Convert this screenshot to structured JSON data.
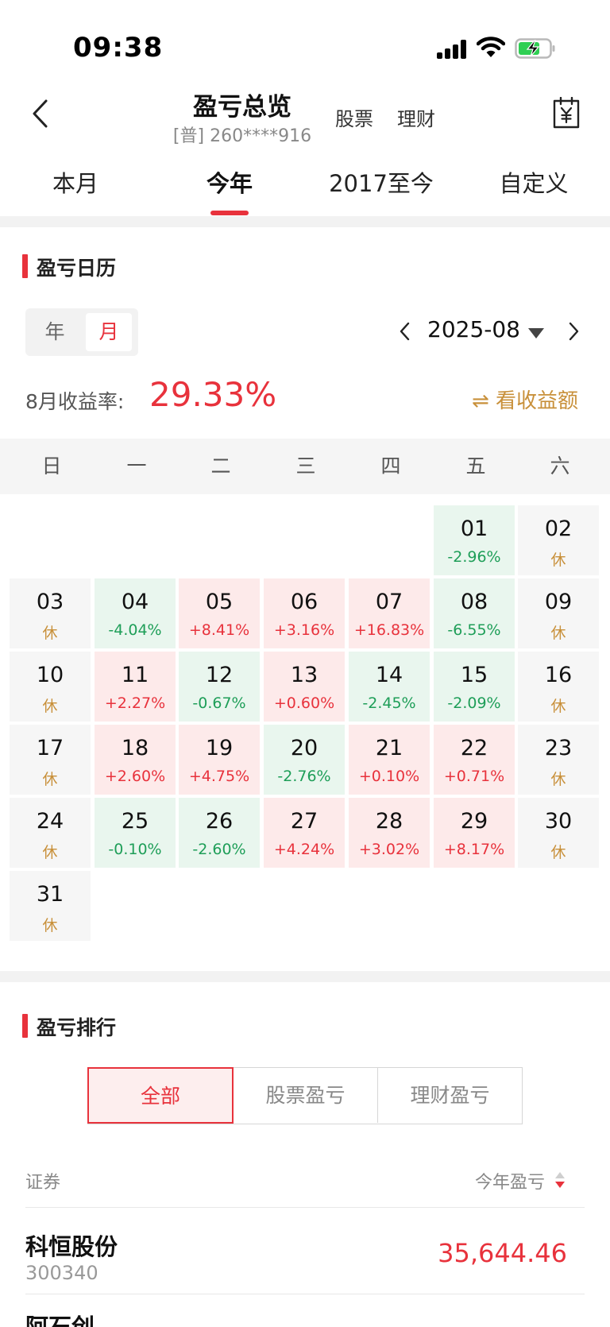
{
  "status_bar": {
    "time": "09:38"
  },
  "nav": {
    "title": "盈亏总览",
    "account": "[普] 260****916",
    "link_stock": "股票",
    "link_finance": "理财"
  },
  "period_tabs": [
    "本月",
    "今年",
    "2017至今",
    "自定义"
  ],
  "period_active": "今年",
  "calendar_section": {
    "title": "盈亏日历",
    "toggle_year": "年",
    "toggle_month": "月",
    "month": "2025-08",
    "rate_label": "8月收益率:",
    "rate_value": "29.33%",
    "toggle_amount": "⇌ 看收益额",
    "weekdays": [
      "日",
      "一",
      "二",
      "三",
      "四",
      "五",
      "六"
    ],
    "days": [
      {
        "d": "01",
        "v": "-2.96%",
        "t": "down"
      },
      {
        "d": "02",
        "v": "休",
        "t": "off"
      },
      {
        "d": "03",
        "v": "休",
        "t": "off"
      },
      {
        "d": "04",
        "v": "-4.04%",
        "t": "down"
      },
      {
        "d": "05",
        "v": "+8.41%",
        "t": "up"
      },
      {
        "d": "06",
        "v": "+3.16%",
        "t": "up"
      },
      {
        "d": "07",
        "v": "+16.83%",
        "t": "up"
      },
      {
        "d": "08",
        "v": "-6.55%",
        "t": "down"
      },
      {
        "d": "09",
        "v": "休",
        "t": "off"
      },
      {
        "d": "10",
        "v": "休",
        "t": "off"
      },
      {
        "d": "11",
        "v": "+2.27%",
        "t": "up"
      },
      {
        "d": "12",
        "v": "-0.67%",
        "t": "down"
      },
      {
        "d": "13",
        "v": "+0.60%",
        "t": "up"
      },
      {
        "d": "14",
        "v": "-2.45%",
        "t": "down"
      },
      {
        "d": "15",
        "v": "-2.09%",
        "t": "down"
      },
      {
        "d": "16",
        "v": "休",
        "t": "off"
      },
      {
        "d": "17",
        "v": "休",
        "t": "off"
      },
      {
        "d": "18",
        "v": "+2.60%",
        "t": "up"
      },
      {
        "d": "19",
        "v": "+4.75%",
        "t": "up"
      },
      {
        "d": "20",
        "v": "-2.76%",
        "t": "down"
      },
      {
        "d": "21",
        "v": "+0.10%",
        "t": "up"
      },
      {
        "d": "22",
        "v": "+0.71%",
        "t": "up"
      },
      {
        "d": "23",
        "v": "休",
        "t": "off"
      },
      {
        "d": "24",
        "v": "休",
        "t": "off"
      },
      {
        "d": "25",
        "v": "-0.10%",
        "t": "down"
      },
      {
        "d": "26",
        "v": "-2.60%",
        "t": "down"
      },
      {
        "d": "27",
        "v": "+4.24%",
        "t": "up"
      },
      {
        "d": "28",
        "v": "+3.02%",
        "t": "up"
      },
      {
        "d": "29",
        "v": "+8.17%",
        "t": "up"
      },
      {
        "d": "30",
        "v": "休",
        "t": "off"
      },
      {
        "d": "31",
        "v": "休",
        "t": "off"
      }
    ]
  },
  "ranking_section": {
    "title": "盈亏排行",
    "tabs": [
      "全部",
      "股票盈亏",
      "理财盈亏"
    ],
    "col_security": "证券",
    "col_pnl": "今年盈亏",
    "rows": [
      {
        "name": "科恒股份",
        "code": "300340",
        "pnl": "35,644.46"
      },
      {
        "name": "阿石创",
        "code": "",
        "pnl": ""
      }
    ]
  },
  "colors": {
    "accent": "#e8323c",
    "gain_bg": "#fdeaea",
    "loss": "#1e9e58",
    "loss_bg": "#e9f6ee",
    "gold": "#c8903a"
  }
}
